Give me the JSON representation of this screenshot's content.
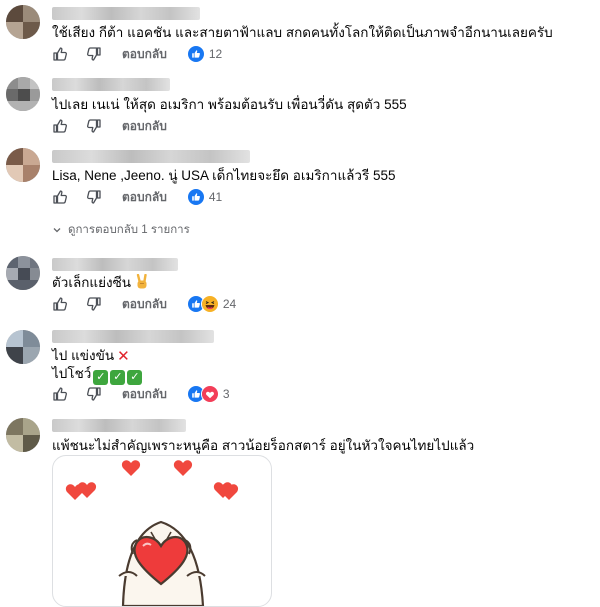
{
  "colors": {
    "like_blue": "#1877f2",
    "text": "#050505",
    "secondary": "#65676b",
    "haha_yellow": "#f7b125",
    "love_red": "#f33e58",
    "check_green": "#3ea63e",
    "cross_red": "#e0242c"
  },
  "reply_label": "ตอบกลับ",
  "comments": [
    {
      "text": "ใช้เสียง กีต้า แอคชัน และสายตาฟ้าแลบ สกดคนทั้งโลกให้ติดเป็นภาพจำอีกนานเลยครับ",
      "reactions": [
        "like"
      ],
      "reaction_count": "12"
    },
    {
      "text": "ไปเลย เนเน่ ให้สุด อเมริกา พร้อมต้อนรับ เพื่อนวี่ดัน สุดตัว 555",
      "reactions": [],
      "reaction_count": ""
    },
    {
      "text": "Lisa, Nene ,Jeeno. นู่ USA เด็กไทยจะยึด อเมริกาแล้วรี 555",
      "reactions": [
        "like"
      ],
      "reaction_count": "41",
      "replies_toggle": "ดูการตอบกลับ 1 รายการ"
    },
    {
      "text": "ตัวเล็กแย่งซีน",
      "emoji": "rock-on-hand",
      "reactions": [
        "like",
        "haha"
      ],
      "reaction_count": "24"
    },
    {
      "line1": "ไป แข่งขัน",
      "line1_emoji": "cross-mark",
      "line2": "ไปโชว์",
      "line2_emoji": "check-marks",
      "reactions": [
        "like",
        "care"
      ],
      "reaction_count": "3"
    },
    {
      "text": "แพ้ชนะไม่สำคัญเพราะหนูคือ สาวน้อยร็อกสตาร์ อยู่ในหัวใจคนไทยไปแล้ว",
      "sticker": "bear-holding-heart-sticker"
    }
  ]
}
